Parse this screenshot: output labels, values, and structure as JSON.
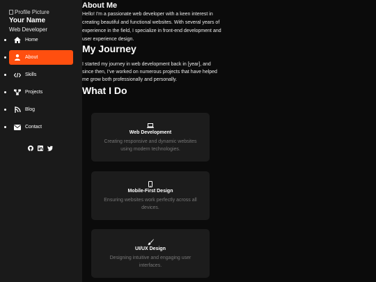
{
  "profile": {
    "picture_alt": "Profile Picture",
    "name": "Your Name",
    "role": "Web Developer"
  },
  "nav": {
    "items": [
      {
        "label": "Home",
        "icon": "home-icon",
        "active": false
      },
      {
        "label": "About",
        "icon": "user-icon",
        "active": true
      },
      {
        "label": "Skills",
        "icon": "code-icon",
        "active": false
      },
      {
        "label": "Projects",
        "icon": "projects-icon",
        "active": false
      },
      {
        "label": "Blog",
        "icon": "blog-icon",
        "active": false
      },
      {
        "label": "Contact",
        "icon": "envelope-icon",
        "active": false
      }
    ]
  },
  "social": [
    "github-icon",
    "linkedin-icon",
    "twitter-icon"
  ],
  "about": {
    "heading": "About Me",
    "text": "Hello! I'm a passionate web developer with a keen interest in creating beautiful and functional websites. With several years of experience in the field, I specialize in front-end development and user experience design."
  },
  "journey": {
    "heading": "My Journey",
    "text": "I started my journey in web development back in [year], and since then, I've worked on numerous projects that have helped me grow both professionally and personally."
  },
  "services": {
    "heading": "What I Do",
    "items": [
      {
        "title": "Web Development",
        "desc": "Creating responsive and dynamic websites using modern technologies.",
        "icon": "laptop-icon"
      },
      {
        "title": "Mobile-First Design",
        "desc": "Ensuring websites work perfectly across all devices.",
        "icon": "mobile-icon"
      },
      {
        "title": "UI/UX Design",
        "desc": "Designing intuitive and engaging user interfaces.",
        "icon": "paintbrush-icon"
      }
    ]
  },
  "colors": {
    "accent": "#ff4f0f",
    "sidebar": "#1a1a1a",
    "card": "#1c1c1c",
    "background": "#0b0b0b"
  }
}
